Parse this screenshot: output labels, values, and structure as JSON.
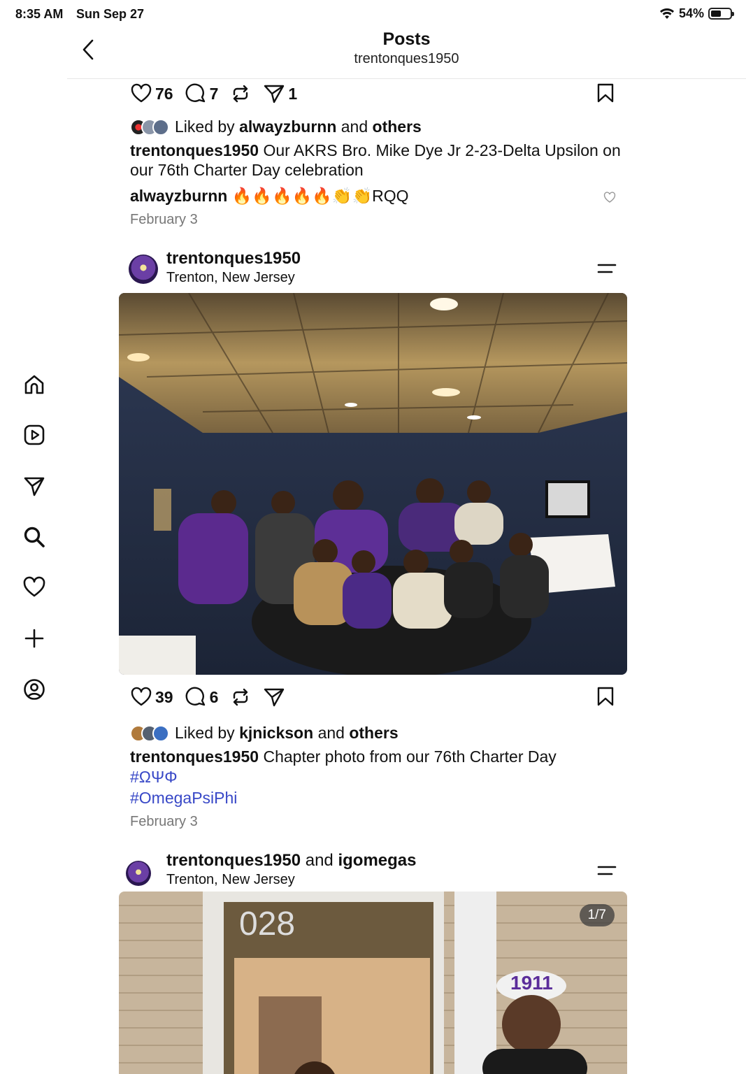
{
  "status_bar": {
    "time": "8:35 AM",
    "date": "Sun Sep 27",
    "battery": "54%",
    "battery_level": 0.54
  },
  "header": {
    "title": "Posts",
    "subtitle": "trentonques1950"
  },
  "nav": [
    "home-icon",
    "reels-icon",
    "send-icon",
    "search-icon",
    "heart-icon",
    "plus-icon",
    "profile-icon"
  ],
  "post1": {
    "likes": "76",
    "comments": "7",
    "shares": "1",
    "liked_by_prefix": "Liked by",
    "liked_by_user": "alwayzburnn",
    "liked_by_and": "and",
    "liked_by_others": "others",
    "caption_user": "trentonques1950",
    "caption_text": "Our AKRS Bro. Mike Dye Jr 2-23-Delta Upsilon on our 76th Charter Day celebration",
    "comment_user": "alwayzburnn",
    "comment_text": "🔥🔥🔥🔥🔥👏👏RQQ",
    "date": "February 3"
  },
  "post2": {
    "user": "trentonques1950",
    "location": "Trenton, New Jersey",
    "likes": "39",
    "comments": "6",
    "liked_by_prefix": "Liked by",
    "liked_by_user": "kjnickson",
    "liked_by_and": "and",
    "liked_by_others": "others",
    "caption_user": "trentonques1950",
    "caption_text": "Chapter photo from our 76th Charter Day",
    "hashtags": [
      "#ΩΨΦ",
      "#OmegaPsiPhi"
    ],
    "date": "February 3"
  },
  "post3": {
    "user": "trentonques1950",
    "and": "and",
    "collab_user": "igomegas",
    "location": "Trenton, New Jersey",
    "counter": "1/7",
    "door_number": "028"
  }
}
